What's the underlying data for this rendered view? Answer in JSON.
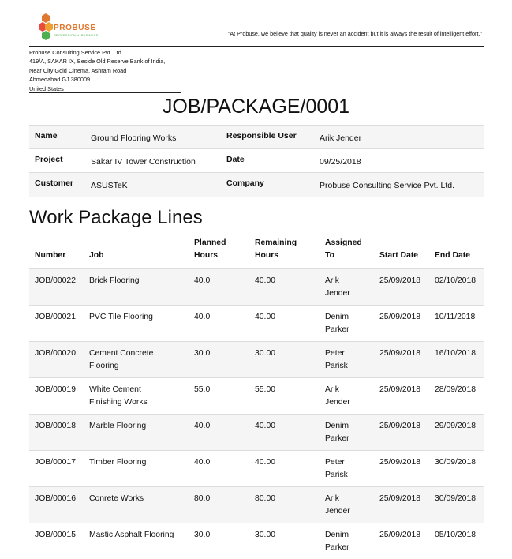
{
  "company": {
    "brand_name": "PROBUSE",
    "brand_tagline": "PROFESSIONAL BUSINESS",
    "quote": "\"At Probuse, we believe that quality is never an accident but it is always the result of intelligent effort.\"",
    "address_lines": [
      "Probuse Consulting Service Pvt. Ltd.",
      "419/A, SAKAR IX, Beside Old Reserve Bank of India,",
      "Near City Gold Cinema, Ashram Road",
      "Ahmedabad GJ 380009",
      "United States"
    ]
  },
  "document": {
    "title": "JOB/PACKAGE/0001"
  },
  "info": {
    "name_label": "Name",
    "name_value": "Ground Flooring Works",
    "responsible_label": "Responsible User",
    "responsible_value": "Arik Jender",
    "project_label": "Project",
    "project_value": "Sakar IV Tower Construction",
    "date_label": "Date",
    "date_value": "09/25/2018",
    "customer_label": "Customer",
    "customer_value": "ASUSTeK",
    "company_label": "Company",
    "company_value": "Probuse Consulting Service Pvt. Ltd."
  },
  "lines_section": {
    "title": "Work Package Lines",
    "headers": {
      "number": "Number",
      "job": "Job",
      "planned_1": "Planned",
      "planned_2": "Hours",
      "remaining_1": "Remaining",
      "remaining_2": "Hours",
      "assigned_1": "Assigned",
      "assigned_2": "To",
      "start": "Start Date",
      "end": "End Date"
    },
    "rows": [
      {
        "number": "JOB/00022",
        "job_1": "Brick Flooring",
        "job_2": "",
        "planned": "40.0",
        "remaining": "40.00",
        "assigned_1": "Arik",
        "assigned_2": "Jender",
        "start": "25/09/2018",
        "end": "02/10/2018"
      },
      {
        "number": "JOB/00021",
        "job_1": "PVC Tile Flooring",
        "job_2": "",
        "planned": "40.0",
        "remaining": "40.00",
        "assigned_1": "Denim",
        "assigned_2": "Parker",
        "start": "25/09/2018",
        "end": "10/11/2018"
      },
      {
        "number": "JOB/00020",
        "job_1": "Cement Concrete",
        "job_2": "Flooring",
        "planned": "30.0",
        "remaining": "30.00",
        "assigned_1": "Peter",
        "assigned_2": "Parisk",
        "start": "25/09/2018",
        "end": "16/10/2018"
      },
      {
        "number": "JOB/00019",
        "job_1": "White Cement",
        "job_2": "Finishing Works",
        "planned": "55.0",
        "remaining": "55.00",
        "assigned_1": "Arik",
        "assigned_2": "Jender",
        "start": "25/09/2018",
        "end": "28/09/2018"
      },
      {
        "number": "JOB/00018",
        "job_1": "Marble Flooring",
        "job_2": "",
        "planned": "40.0",
        "remaining": "40.00",
        "assigned_1": "Denim",
        "assigned_2": "Parker",
        "start": "25/09/2018",
        "end": "29/09/2018"
      },
      {
        "number": "JOB/00017",
        "job_1": "Timber Flooring",
        "job_2": "",
        "planned": "40.0",
        "remaining": "40.00",
        "assigned_1": "Peter",
        "assigned_2": "Parisk",
        "start": "25/09/2018",
        "end": "30/09/2018"
      },
      {
        "number": "JOB/00016",
        "job_1": "Conrete Works",
        "job_2": "",
        "planned": "80.0",
        "remaining": "80.00",
        "assigned_1": "Arik",
        "assigned_2": "Jender",
        "start": "25/09/2018",
        "end": "30/09/2018"
      },
      {
        "number": "JOB/00015",
        "job_1": "Mastic Asphalt Flooring",
        "job_2": "",
        "planned": "30.0",
        "remaining": "30.00",
        "assigned_1": "Denim",
        "assigned_2": "Parker",
        "start": "25/09/2018",
        "end": "05/10/2018"
      }
    ]
  },
  "colors": {
    "brand_orange": "#e0782f",
    "brand_green": "#4caf50",
    "row_stripe": "#f5f5f5",
    "rule": "#dddddd"
  }
}
